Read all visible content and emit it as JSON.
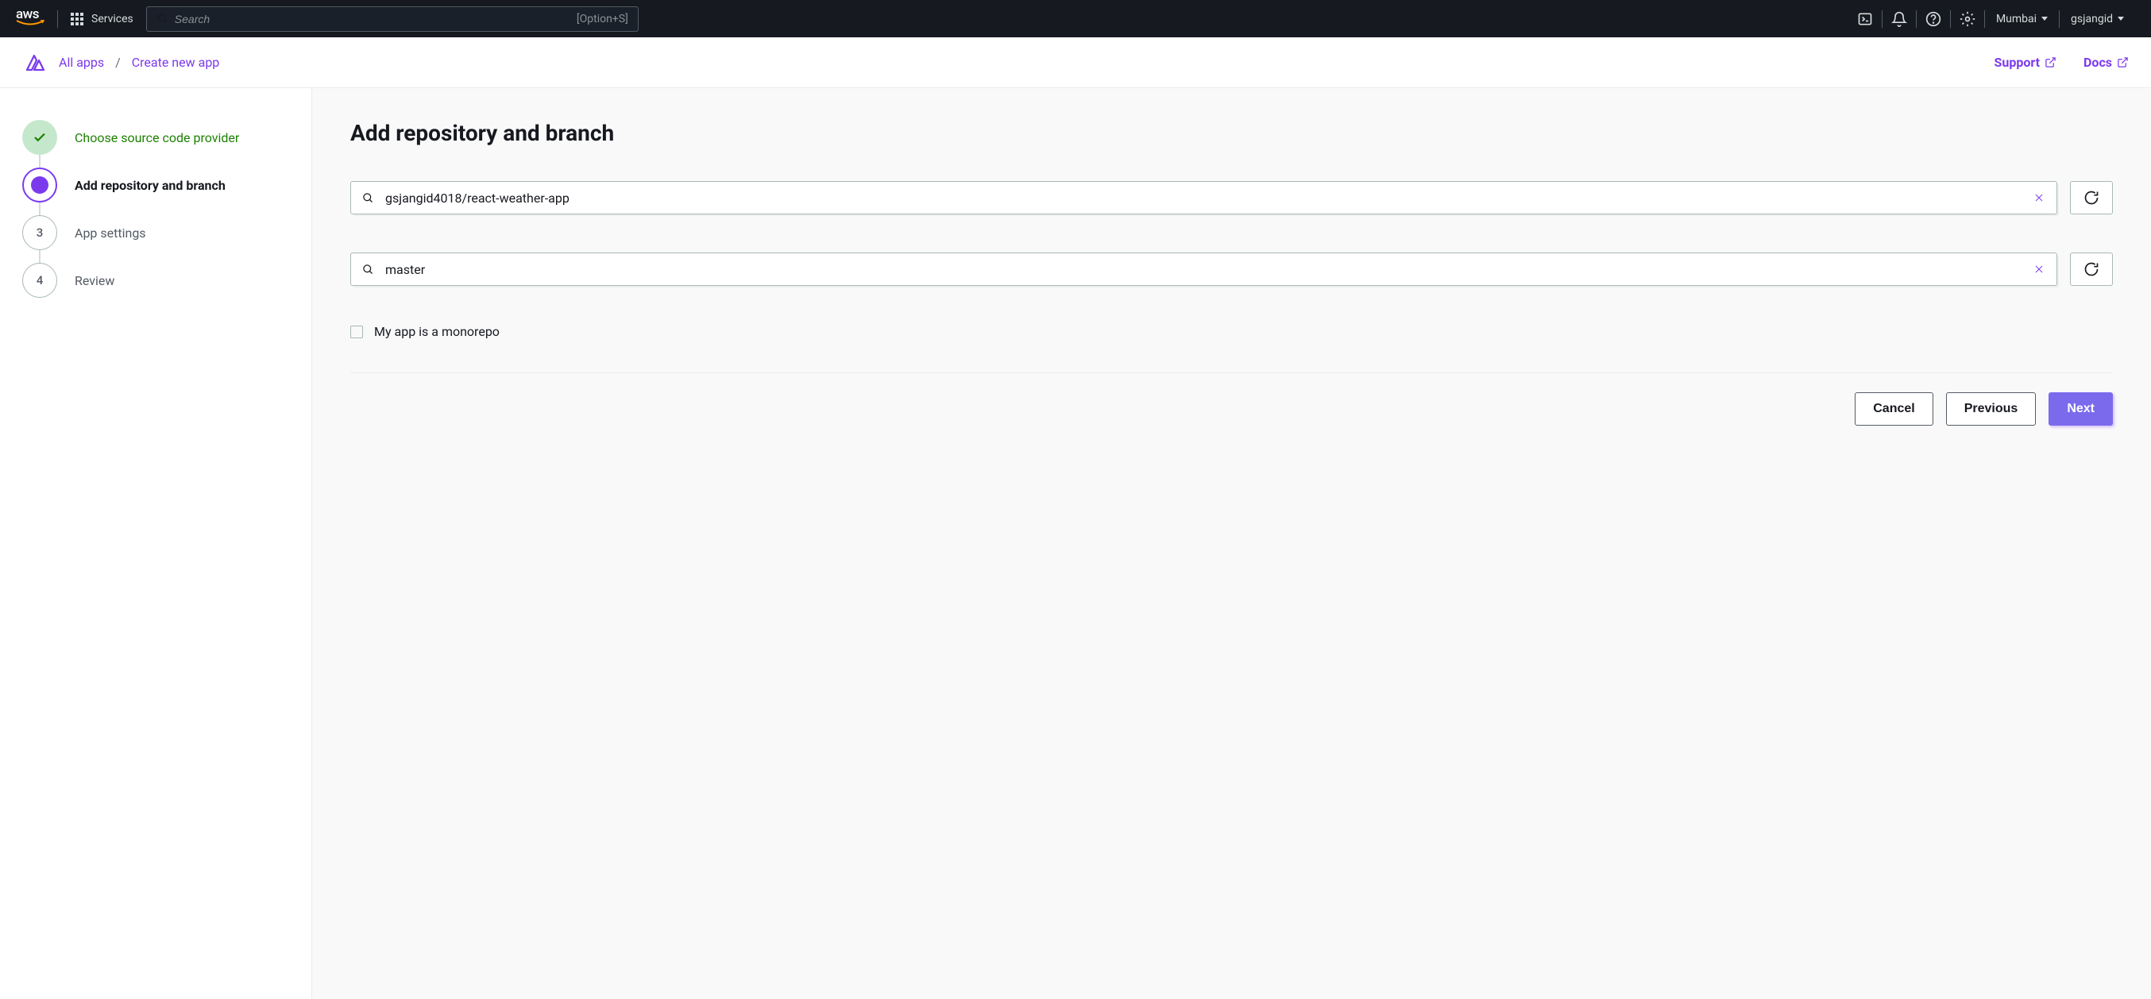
{
  "header": {
    "logo": "aws",
    "services_label": "Services",
    "search_placeholder": "Search",
    "search_shortcut": "[Option+S]",
    "region": "Mumbai",
    "username": "gsjangid"
  },
  "breadcrumb": {
    "items": [
      "All apps",
      "Create new app"
    ],
    "support_label": "Support",
    "docs_label": "Docs"
  },
  "wizard": {
    "steps": [
      {
        "label": "Choose source code provider",
        "state": "completed"
      },
      {
        "label": "Add repository and branch",
        "state": "active"
      },
      {
        "label": "App settings",
        "state": "pending",
        "number": "3"
      },
      {
        "label": "Review",
        "state": "pending",
        "number": "4"
      }
    ]
  },
  "content": {
    "title": "Add repository and branch",
    "repository_value": "gsjangid4018/react-weather-app",
    "branch_value": "master",
    "monorepo_label": "My app is a monorepo",
    "buttons": {
      "cancel": "Cancel",
      "previous": "Previous",
      "next": "Next"
    }
  }
}
